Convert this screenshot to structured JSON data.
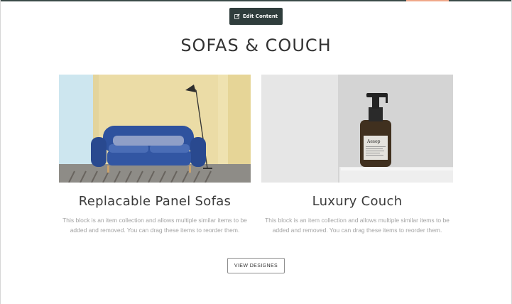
{
  "toolbar": {
    "edit_label": "Edit Content",
    "edit_icon": "edit-icon"
  },
  "section": {
    "title": "SOFAS & COUCH"
  },
  "cards": [
    {
      "title": "Replacable Panel Sofas",
      "description": "This block is an item collection and allows multiple similar items to be added and removed. You can drag these items to reorder them.",
      "image": "blue-sofa-photo"
    },
    {
      "title": "Luxury Couch",
      "description": "This block is an item collection and allows multiple similar items to be added and removed. You can drag these items to reorder them.",
      "image": "soap-bottle-photo",
      "bottle_label": "Aesop"
    }
  ],
  "cta": {
    "label": "VIEW DESIGNES"
  },
  "colors": {
    "dark_teal": "#2f3d3c",
    "accent": "#f0a88a",
    "text": "#333333",
    "muted": "#a3a3a3"
  }
}
